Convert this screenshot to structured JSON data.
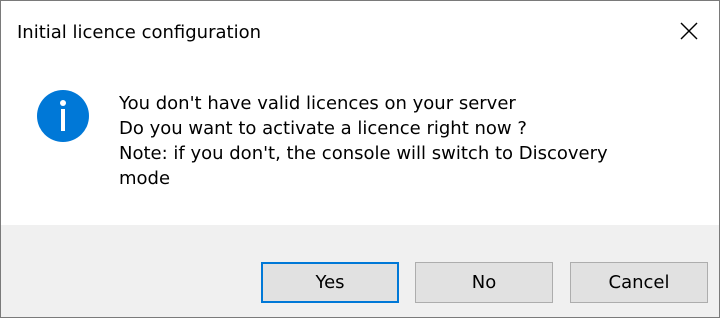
{
  "window": {
    "title": "Initial licence configuration",
    "close_icon": "close-icon"
  },
  "message": {
    "icon": "info-icon",
    "icon_color": "#0078d7",
    "lines": [
      "You don't have valid licences on your server",
      "Do you want to activate a licence right now ?",
      "Note: if you don't, the console will switch to Discovery",
      "mode"
    ]
  },
  "buttons": {
    "yes": "Yes",
    "no": "No",
    "cancel": "Cancel",
    "default": "yes"
  },
  "colors": {
    "accent": "#0078d7",
    "footer_bg": "#f0f0f0",
    "button_bg": "#e1e1e1"
  }
}
